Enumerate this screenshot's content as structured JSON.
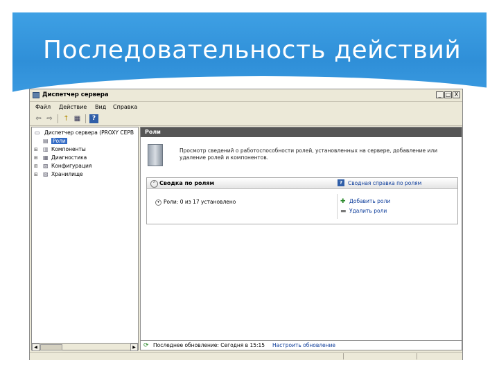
{
  "slide": {
    "title": "Последовательность действий",
    "accent_color": "#3a9ae0"
  },
  "window": {
    "title": "Диспетчер сервера",
    "controls": {
      "minimize": "_",
      "maximize": "□",
      "close": "X"
    }
  },
  "menu": [
    "Файл",
    "Действие",
    "Вид",
    "Справка"
  ],
  "toolbar": {
    "icons": [
      "back-arrow-icon",
      "forward-arrow-icon",
      "up-folder-icon",
      "properties-icon",
      "help-icon"
    ],
    "glyphs": [
      "⇦",
      "⇨",
      "↑",
      "▦",
      "?"
    ]
  },
  "tree": {
    "items": [
      {
        "label": "Диспетчер сервера (PROXY СЕРВ",
        "icon": "server-manager-icon",
        "glyph": "▭",
        "expander": ""
      },
      {
        "label": "Роли",
        "icon": "roles-icon",
        "glyph": "▤",
        "expander": ""
      },
      {
        "label": "Компоненты",
        "icon": "features-icon",
        "glyph": "▥",
        "expander": "⊞"
      },
      {
        "label": "Диагностика",
        "icon": "diagnostics-icon",
        "glyph": "▦",
        "expander": "⊞"
      },
      {
        "label": "Конфигурация",
        "icon": "configuration-icon",
        "glyph": "▧",
        "expander": "⊞"
      },
      {
        "label": "Хранилище",
        "icon": "storage-icon",
        "glyph": "▨",
        "expander": "⊞"
      }
    ],
    "scroll": {
      "left": "◀",
      "right": "▶"
    }
  },
  "roles_pane": {
    "header": "Роли",
    "description": "Просмотр сведений о работоспособности ролей, установленных на сервере, добавление или удаление ролей и компонентов.",
    "summary": {
      "title": "Сводка по ролям",
      "collapse_glyph": "⌃",
      "help_glyph": "?",
      "help_link": "Сводная справка по ролям",
      "status_glyph": "▾",
      "status": "Роли: 0 из 17 установлено",
      "actions": [
        {
          "label": "Добавить роли",
          "icon": "add-roles-icon",
          "glyph": "✚"
        },
        {
          "label": "Удалить роли",
          "icon": "remove-roles-icon",
          "glyph": "▬"
        }
      ]
    },
    "refresh": {
      "glyph": "⟳",
      "text": "Последнее обновление: Сегодня в 15:15",
      "link": "Настроить обновление"
    }
  }
}
